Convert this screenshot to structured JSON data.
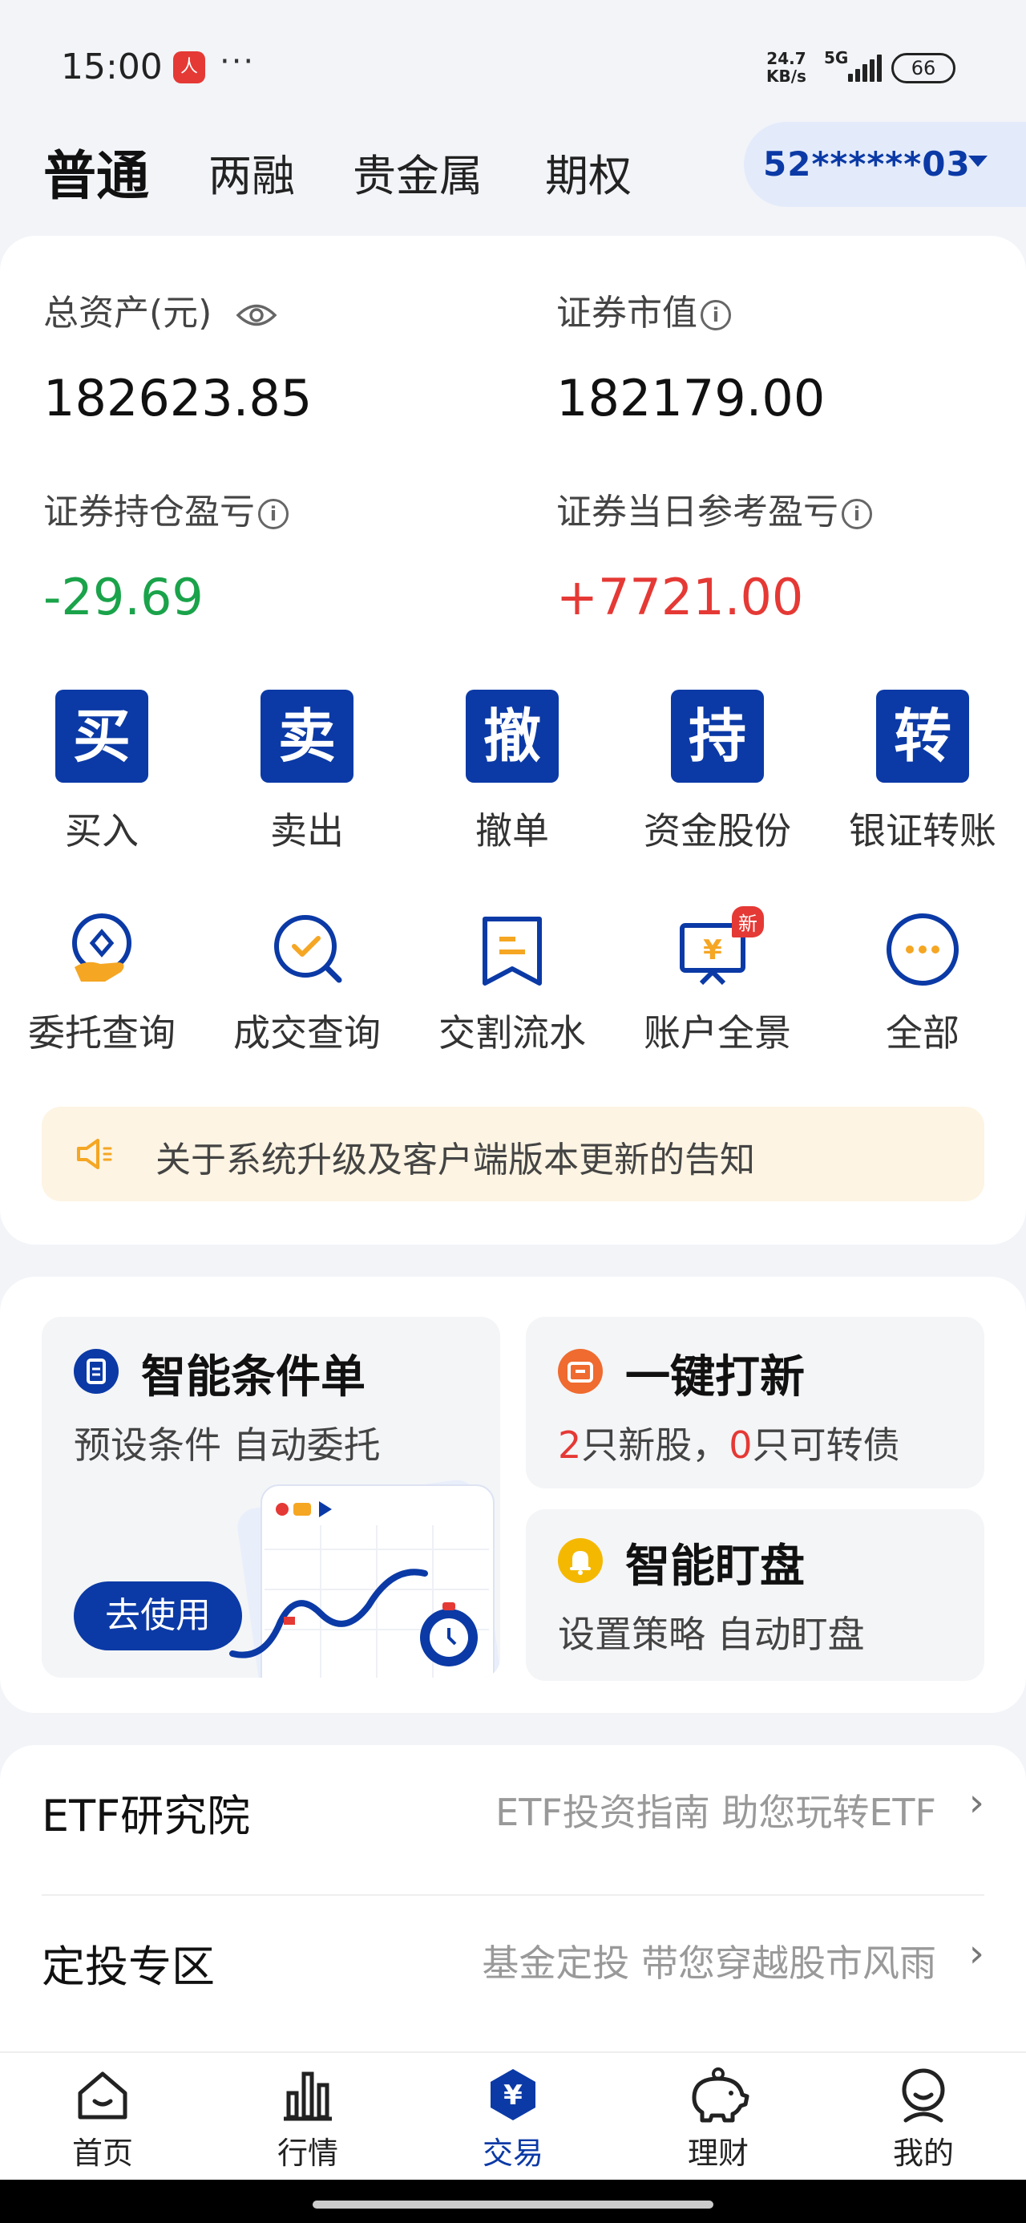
{
  "status_bar": {
    "time": "15:00",
    "app_icon_text": "人",
    "dots": "···",
    "net_speed_value": "24.7",
    "net_speed_unit": "KB/s",
    "network": "5G",
    "battery": "66"
  },
  "tabs": [
    {
      "label": "普通",
      "active": true
    },
    {
      "label": "两融",
      "active": false
    },
    {
      "label": "贵金属",
      "active": false
    },
    {
      "label": "期权",
      "active": false
    }
  ],
  "account": {
    "number": "52******03"
  },
  "assets": {
    "total_label": "总资产(元)",
    "total_value": "182623.85",
    "market_label": "证券市值",
    "market_value": "182179.00",
    "position_pl_label": "证券持仓盈亏",
    "position_pl_value": "-29.69",
    "daily_pl_label": "证券当日参考盈亏",
    "daily_pl_value": "+7721.00"
  },
  "colors": {
    "brand": "#0b3aa6",
    "loss": "#1aa34a",
    "gain": "#e53935",
    "notice_bg": "#fdf4e3"
  },
  "quick_actions": [
    {
      "glyph": "买",
      "label": "买入"
    },
    {
      "glyph": "卖",
      "label": "卖出"
    },
    {
      "glyph": "撤",
      "label": "撤单"
    },
    {
      "glyph": "持",
      "label": "资金股份"
    },
    {
      "glyph": "转",
      "label": "银证转账"
    }
  ],
  "tools": [
    {
      "icon": "entrust-query-icon",
      "label": "委托查询"
    },
    {
      "icon": "deal-query-icon",
      "label": "成交查询"
    },
    {
      "icon": "settlement-flow-icon",
      "label": "交割流水"
    },
    {
      "icon": "account-overview-icon",
      "label": "账户全景",
      "badge": "新"
    },
    {
      "icon": "more-icon",
      "label": "全部"
    }
  ],
  "notice": {
    "text": "关于系统升级及客户端版本更新的告知"
  },
  "features": {
    "smart_order": {
      "title": "智能条件单",
      "subtitle": "预设条件 自动委托",
      "button": "去使用"
    },
    "ipo": {
      "title": "一键打新",
      "count_stocks": "2",
      "stocks_text": "只新股，",
      "count_bonds": "0",
      "bonds_text": "只可转债"
    },
    "watch": {
      "title": "智能盯盘",
      "subtitle": "设置策略 自动盯盘"
    }
  },
  "links": [
    {
      "title": "ETF研究院",
      "subtitle": "ETF投资指南 助您玩转ETF"
    },
    {
      "title": "定投专区",
      "subtitle": "基金定投 带您穿越股市风雨"
    }
  ],
  "bottom_nav": [
    {
      "icon": "home-icon",
      "label": "首页"
    },
    {
      "icon": "market-icon",
      "label": "行情"
    },
    {
      "icon": "trade-icon",
      "label": "交易",
      "glyph": "¥",
      "active": true
    },
    {
      "icon": "wealth-icon",
      "label": "理财"
    },
    {
      "icon": "profile-icon",
      "label": "我的"
    }
  ]
}
